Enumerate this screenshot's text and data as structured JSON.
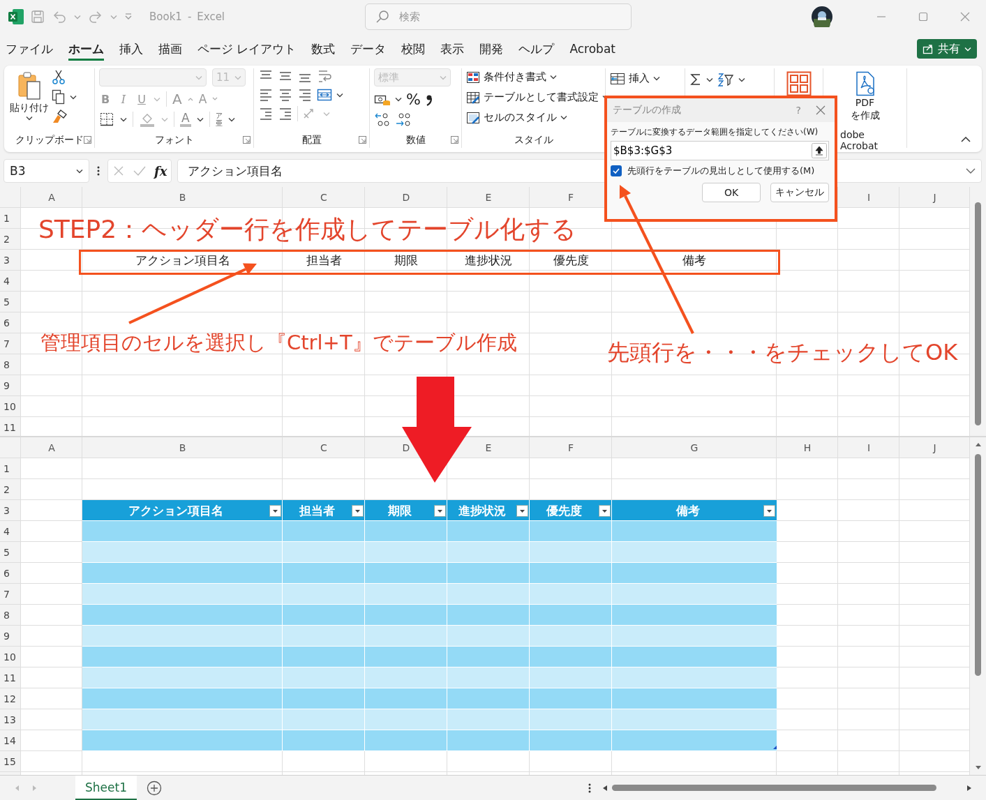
{
  "title_bar": {
    "document": "Book1",
    "separator": "-",
    "app": "Excel",
    "search": {
      "placeholder": "検索"
    }
  },
  "menu_tabs": [
    {
      "label": "ファイル",
      "selected": false
    },
    {
      "label": "ホーム",
      "selected": true
    },
    {
      "label": "挿入",
      "selected": false
    },
    {
      "label": "描画",
      "selected": false
    },
    {
      "label": "ページ レイアウト",
      "selected": false
    },
    {
      "label": "数式",
      "selected": false
    },
    {
      "label": "データ",
      "selected": false
    },
    {
      "label": "校閲",
      "selected": false
    },
    {
      "label": "表示",
      "selected": false
    },
    {
      "label": "開発",
      "selected": false
    },
    {
      "label": "ヘルプ",
      "selected": false
    },
    {
      "label": "Acrobat",
      "selected": false
    }
  ],
  "share_button": {
    "label": "共有"
  },
  "ribbon": {
    "clipboard": {
      "paste": "貼り付け",
      "label": "クリップボード"
    },
    "font": {
      "size": "11",
      "styles": [
        "B",
        "I",
        "U"
      ],
      "grow": "A",
      "shrink": "A",
      "font_color": "A",
      "phonetic": "ア亜",
      "label": "フォント"
    },
    "alignment": {
      "label": "配置"
    },
    "number": {
      "format": "標準",
      "percent": "%",
      "label": "数値"
    },
    "styles": {
      "items": [
        "条件付き書式",
        "テーブルとして書式設定",
        "セルのスタイル"
      ],
      "label": "スタイル"
    },
    "cells": {
      "insert": "挿入"
    },
    "acrobat": {
      "button": [
        "PDF",
        "を作成"
      ],
      "label": "dobe Acrobat"
    }
  },
  "formula_bar": {
    "name_box": "B3",
    "function_button": "fx",
    "formula": "アクション項目名"
  },
  "annotations": {
    "title": "STEP2：ヘッダー行を作成してテーブル化する",
    "note_select": "管理項目のセルを選択し『Ctrl+T』でテーブル作成",
    "note_check": "先頭行を・・・をチェックしてOK"
  },
  "sheet_top": {
    "columns_left": [
      "A",
      "B",
      "C",
      "D",
      "E",
      "F"
    ],
    "columns_right": [
      "I",
      "J"
    ],
    "rows": [
      {
        "number": "1"
      },
      {
        "number": "2"
      },
      {
        "number": "3",
        "values": [
          "アクション項目名",
          "担当者",
          "期限",
          "進捗状況",
          "優先度",
          "備考"
        ]
      },
      {
        "number": "4"
      },
      {
        "number": "5"
      },
      {
        "number": "6"
      },
      {
        "number": "7"
      },
      {
        "number": "8"
      },
      {
        "number": "9"
      },
      {
        "number": "10"
      },
      {
        "number": "11"
      }
    ]
  },
  "dialog": {
    "title": "テーブルの作成",
    "help": "?",
    "prompt": "テーブルに変換するデータ範囲を指定してください(W)",
    "range": "$B$3:$G$3",
    "checkbox": {
      "label": "先頭行をテーブルの見出しとして使用する(M)",
      "checked": true
    },
    "buttons": [
      "OK",
      "キャンセル"
    ]
  },
  "sheet_bottom": {
    "columns": [
      "A",
      "B",
      "C",
      "D",
      "E",
      "F",
      "G",
      "H",
      "I",
      "J"
    ],
    "rows": [
      {
        "number": "1"
      },
      {
        "number": "2"
      },
      {
        "number": "3",
        "table_header": [
          "アクション項目名",
          "担当者",
          "期限",
          "進捗状況",
          "優先度",
          "備考"
        ]
      },
      {
        "number": "4",
        "shaded": true
      },
      {
        "number": "5",
        "shaded": false
      },
      {
        "number": "6",
        "shaded": true
      },
      {
        "number": "7",
        "shaded": false
      },
      {
        "number": "8",
        "shaded": true
      },
      {
        "number": "9",
        "shaded": false
      },
      {
        "number": "10",
        "shaded": true
      },
      {
        "number": "11",
        "shaded": false
      },
      {
        "number": "12",
        "shaded": true
      },
      {
        "number": "13",
        "shaded": false
      },
      {
        "number": "14",
        "shaded": true
      },
      {
        "number": "15"
      }
    ]
  },
  "sheet_tabs": [
    {
      "label": "Sheet1",
      "selected": true
    }
  ]
}
